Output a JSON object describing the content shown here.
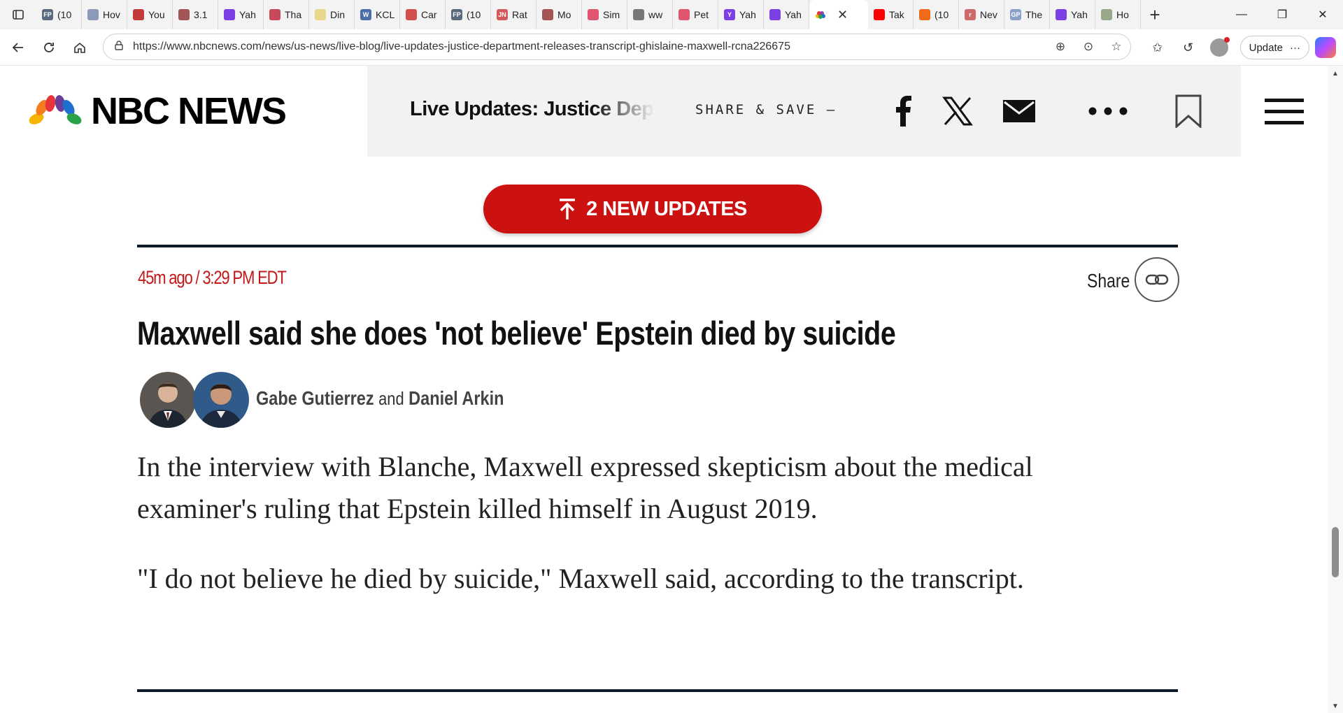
{
  "browser": {
    "tabs": [
      {
        "label": "(10",
        "fav_color": "#5a6b7d",
        "fav_text": "FP"
      },
      {
        "label": "Hov",
        "fav_color": "#8a9ab8",
        "fav_text": ""
      },
      {
        "label": "You",
        "fav_color": "#c23b3b",
        "fav_text": ""
      },
      {
        "label": "3.1",
        "fav_color": "#a45555",
        "fav_text": ""
      },
      {
        "label": "Yah",
        "fav_color": "#7b3fe4",
        "fav_text": ""
      },
      {
        "label": "Tha",
        "fav_color": "#c84a5a",
        "fav_text": ""
      },
      {
        "label": "Din",
        "fav_color": "#e8d88c",
        "fav_text": ""
      },
      {
        "label": "KCL",
        "fav_color": "#4a6ea8",
        "fav_text": "W"
      },
      {
        "label": "Car",
        "fav_color": "#d05050",
        "fav_text": ""
      },
      {
        "label": "(10",
        "fav_color": "#5a6b7d",
        "fav_text": "FP"
      },
      {
        "label": "Rat",
        "fav_color": "#d45a5a",
        "fav_text": "JN"
      },
      {
        "label": "Mo",
        "fav_color": "#a45555",
        "fav_text": ""
      },
      {
        "label": "Sim",
        "fav_color": "#e05570",
        "fav_text": ""
      },
      {
        "label": "ww",
        "fav_color": "#777777",
        "fav_text": ""
      },
      {
        "label": "Pet",
        "fav_color": "#e05570",
        "fav_text": ""
      },
      {
        "label": "Yah",
        "fav_color": "#7b3fe4",
        "fav_text": "Y"
      },
      {
        "label": "Yah",
        "fav_color": "#7b3fe4",
        "fav_text": ""
      }
    ],
    "active_tab": {
      "label": "",
      "close": "✕"
    },
    "tabs_after": [
      {
        "label": "Tak",
        "fav_color": "#ff0000",
        "fav_text": ""
      },
      {
        "label": "(10",
        "fav_color": "#f06a1a",
        "fav_text": ""
      },
      {
        "label": "Nev",
        "fav_color": "#d06a6a",
        "fav_text": "r"
      },
      {
        "label": "The",
        "fav_color": "#8aa0c8",
        "fav_text": "GP"
      },
      {
        "label": "Yah",
        "fav_color": "#7b3fe4",
        "fav_text": ""
      },
      {
        "label": "Ho",
        "fav_color": "#9aa88a",
        "fav_text": ""
      }
    ],
    "url": "https://www.nbcnews.com/news/us-news/live-blog/live-updates-justice-department-releases-transcript-ghislaine-maxwell-rcna226675",
    "update_label": "Update",
    "update_more": "···"
  },
  "site": {
    "logo_text": "NBC NEWS",
    "header_title": "Live Updates: Justice Department releases transcript",
    "share_save": "SHARE & SAVE —",
    "brand_red": "#cc1111"
  },
  "updates_button": {
    "label": "2 NEW UPDATES"
  },
  "post": {
    "timestamp": "45m ago / 3:29 PM EDT",
    "share_label": "Share",
    "headline": "Maxwell said she does 'not believe' Epstein died by suicide",
    "author1": "Gabe Gutierrez",
    "conjunction": "and",
    "author2": "Daniel Arkin",
    "paragraphs": [
      "In the interview with Blanche, Maxwell expressed skepticism about the medical examiner's ruling that Epstein killed himself in August 2019.",
      "\"I do not believe he died by suicide,\" Maxwell said, according to the transcript."
    ]
  }
}
